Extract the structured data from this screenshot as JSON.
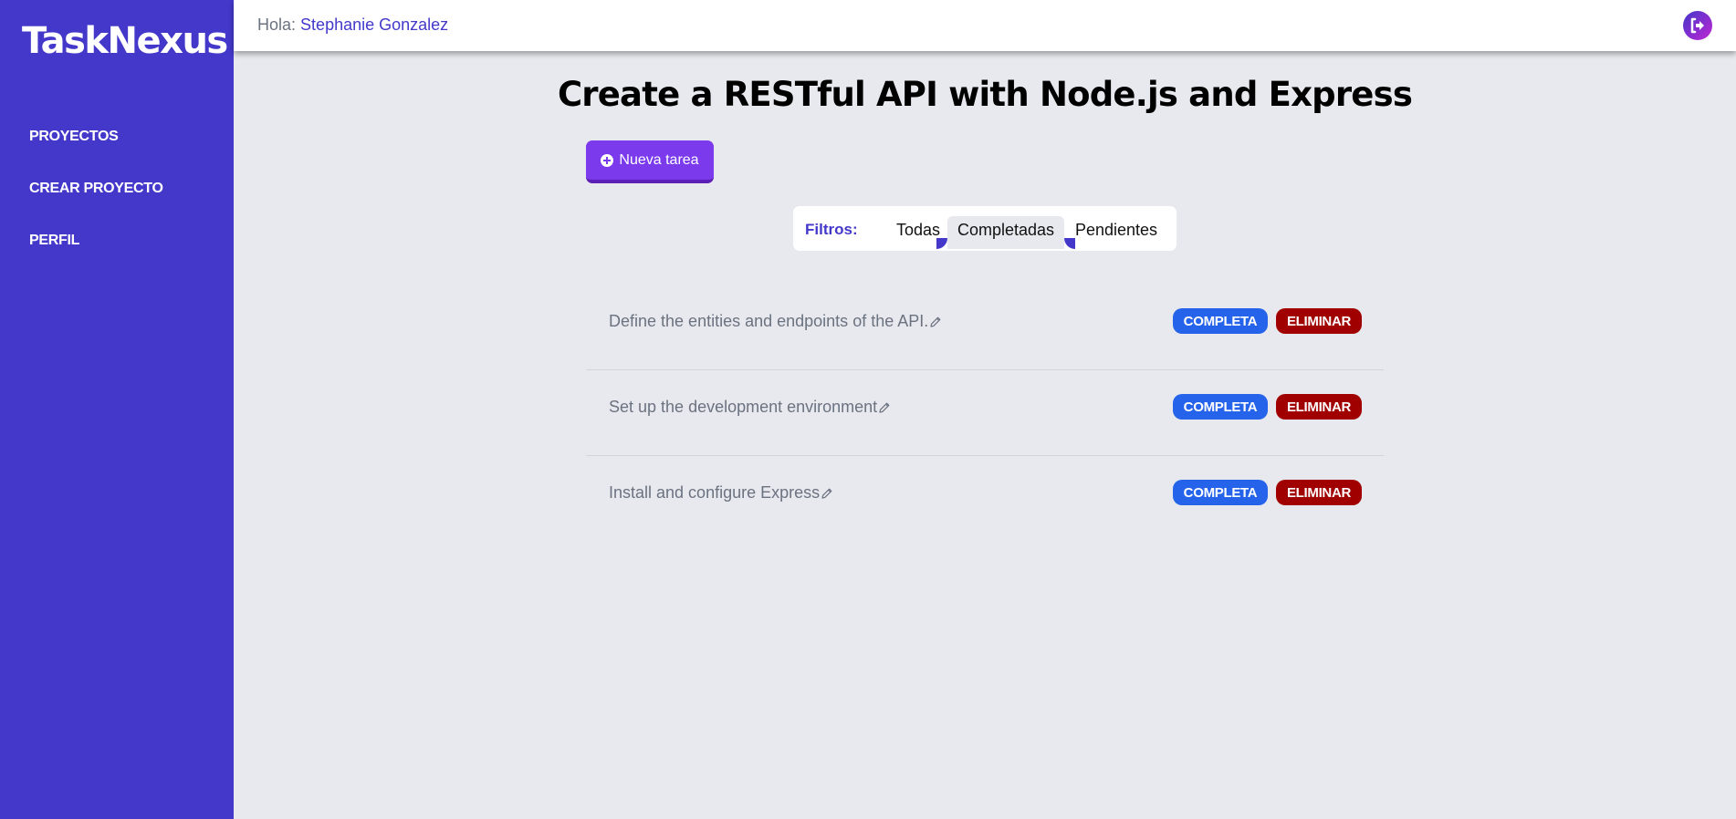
{
  "sidebar": {
    "brand": "TaskNexus",
    "items": [
      {
        "label": "PROYECTOS"
      },
      {
        "label": "CREAR PROYECTO"
      },
      {
        "label": "PERFIL"
      }
    ]
  },
  "header": {
    "greeting_label": "Hola:",
    "user_name": "Stephanie Gonzalez",
    "logout_icon": "logout-icon"
  },
  "page": {
    "title": "Create a RESTful API with Node.js and Express",
    "new_task_label": "Nueva tarea"
  },
  "filters": {
    "label": "Filtros:",
    "options": [
      "Todas",
      "Completadas",
      "Pendientes"
    ],
    "selected": "Completadas"
  },
  "tasks": [
    {
      "text": "Define the entities and endpoints of the API.",
      "complete_label": "COMPLETA",
      "delete_label": "ELIMINAR"
    },
    {
      "text": "Set up the development environment",
      "complete_label": "COMPLETA",
      "delete_label": "ELIMINAR"
    },
    {
      "text": "Install and configure Express",
      "complete_label": "COMPLETA",
      "delete_label": "ELIMINAR"
    }
  ],
  "colors": {
    "sidebar": "#4338ca",
    "accent": "#7c3aed",
    "complete": "#2563eb",
    "delete": "#a00000",
    "background": "#e8e9ee"
  }
}
